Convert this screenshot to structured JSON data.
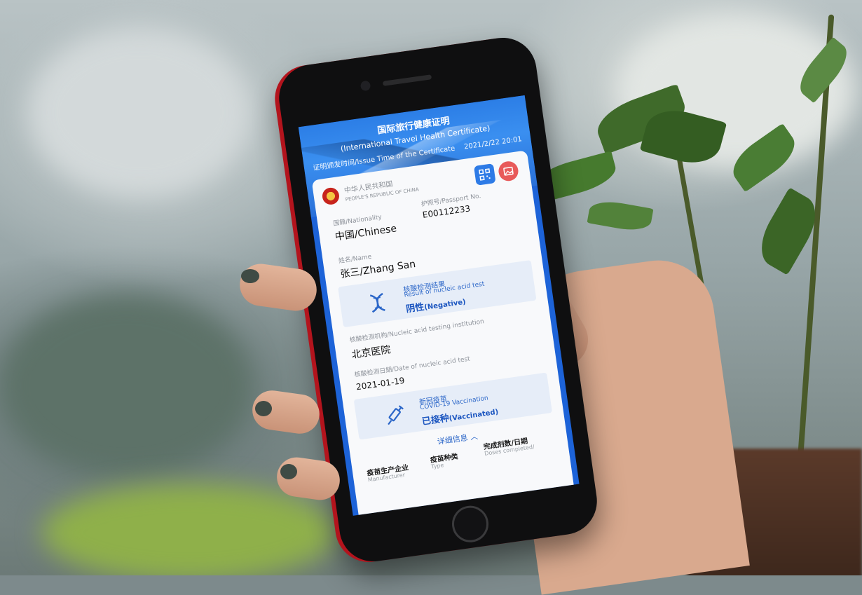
{
  "certificate": {
    "title_cn": "国际旅行健康证明",
    "title_en": "(International Travel Health Certificate)",
    "issue_label": "证明颁发时间/Issue Time of the Certificate",
    "issue_time": "2021/2/22 20:01",
    "country_cn": "中华人民共和国",
    "country_en": "PEOPLE'S REPUBLIC OF CHINA"
  },
  "fields": {
    "nationality_label": "国籍/Nationality",
    "nationality_value": "中国/Chinese",
    "passport_label": "护照号/Passport No.",
    "passport_value": "E00112233",
    "name_label": "姓名/Name",
    "name_value": "张三/Zhang San",
    "institution_label": "核酸检测机构/Nucleic acid testing institution",
    "institution_value": "北京医院",
    "date_label": "核酸检测日期/Date of nucleic acid test",
    "date_value": "2021-01-19"
  },
  "nucleic_result": {
    "title_cn": "核酸检测结果",
    "title_en": "Result of nucleic acid test",
    "value_cn": "阴性",
    "value_en": "(Negative)"
  },
  "vaccination": {
    "title_cn": "新冠疫苗",
    "title_en": "COVID-19 Vaccination",
    "value_cn": "已接种",
    "value_en": "(Vaccinated)"
  },
  "details": {
    "toggle_label": "详细信息 ︿",
    "col_manufacturer": "疫苗生产企业",
    "col_manufacturer_en": "Manufacturer",
    "col_type": "疫苗种类",
    "col_type_en": "Type",
    "col_doses": "完成剂数/日期",
    "col_doses_en": "Doses completed/"
  },
  "icons": [
    "qr-code-icon",
    "picture-icon",
    "dna-icon",
    "syringe-icon",
    "national-emblem-icon"
  ],
  "colors": {
    "accent": "#2b66c8",
    "header": "#2c7ee6",
    "phone_frame": "#b3141d"
  }
}
